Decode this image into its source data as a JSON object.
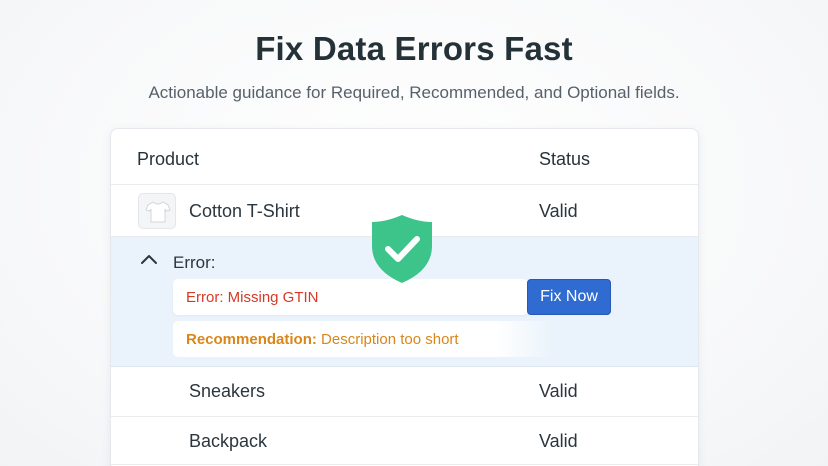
{
  "header": {
    "title": "Fix Data Errors Fast",
    "subtitle": "Actionable guidance for Required, Recommended, and Optional fields."
  },
  "table": {
    "columns": [
      "Product",
      "Status"
    ],
    "rows": [
      {
        "product": "Cotton T-Shirt",
        "status": "Valid",
        "thumbnail_icon": "tshirt-icon"
      },
      {
        "product": "Sneakers",
        "status": "Valid"
      },
      {
        "product": "Backpack",
        "status": "Valid"
      }
    ],
    "expanded": {
      "heading": "Error:",
      "toggle_icon": "chevron-up-icon",
      "error_text": "Error: Missing GTIN",
      "fix_button": "Fix Now",
      "recommendation_label": "Recommendation:",
      "recommendation_text": " Description too short"
    }
  },
  "overlay": {
    "icon": "shield-check-icon"
  },
  "colors": {
    "accent_blue": "#2f6bd0",
    "error_red": "#d63a26",
    "recommendation_orange": "#d9861a",
    "expanded_bg": "#eaf3fb",
    "shield_green": "#3cc48a"
  }
}
